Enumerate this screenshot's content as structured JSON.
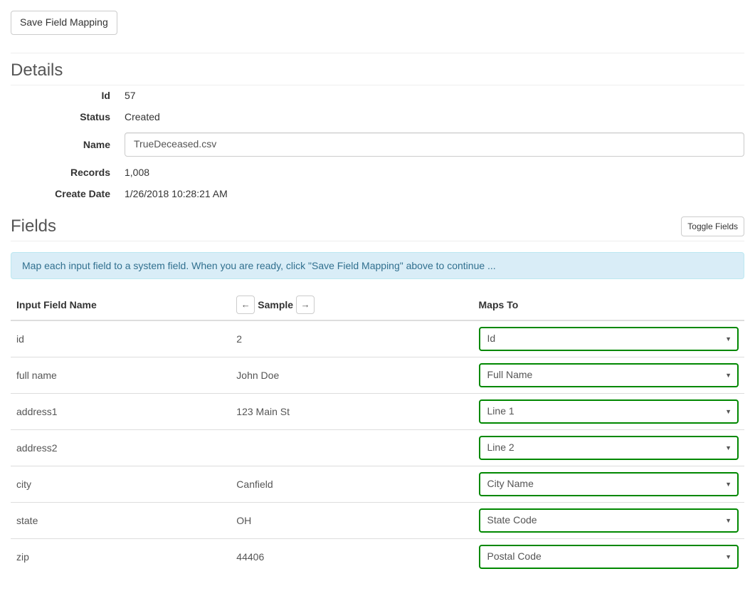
{
  "topbar": {
    "save_label": "Save Field Mapping"
  },
  "details": {
    "heading": "Details",
    "labels": {
      "id": "Id",
      "status": "Status",
      "name": "Name",
      "records": "Records",
      "create_date": "Create Date"
    },
    "values": {
      "id": "57",
      "status": "Created",
      "name": "TrueDeceased.csv",
      "records": "1,008",
      "create_date": "1/26/2018 10:28:21 AM"
    }
  },
  "fields": {
    "heading": "Fields",
    "toggle_label": "Toggle Fields",
    "info_text": "Map each input field to a system field. When you are ready, click \"Save Field Mapping\" above to continue ...",
    "columns": {
      "input": "Input Field Name",
      "sample": "Sample",
      "mapsto": "Maps To"
    },
    "rows": [
      {
        "input": "id",
        "sample": "2",
        "mapsto": "Id"
      },
      {
        "input": "full name",
        "sample": "John Doe",
        "mapsto": "Full Name"
      },
      {
        "input": "address1",
        "sample": "123 Main St",
        "mapsto": "Line 1"
      },
      {
        "input": "address2",
        "sample": "",
        "mapsto": "Line 2"
      },
      {
        "input": "city",
        "sample": "Canfield",
        "mapsto": "City Name"
      },
      {
        "input": "state",
        "sample": "OH",
        "mapsto": "State Code"
      },
      {
        "input": "zip",
        "sample": "44406",
        "mapsto": "Postal Code"
      }
    ]
  }
}
